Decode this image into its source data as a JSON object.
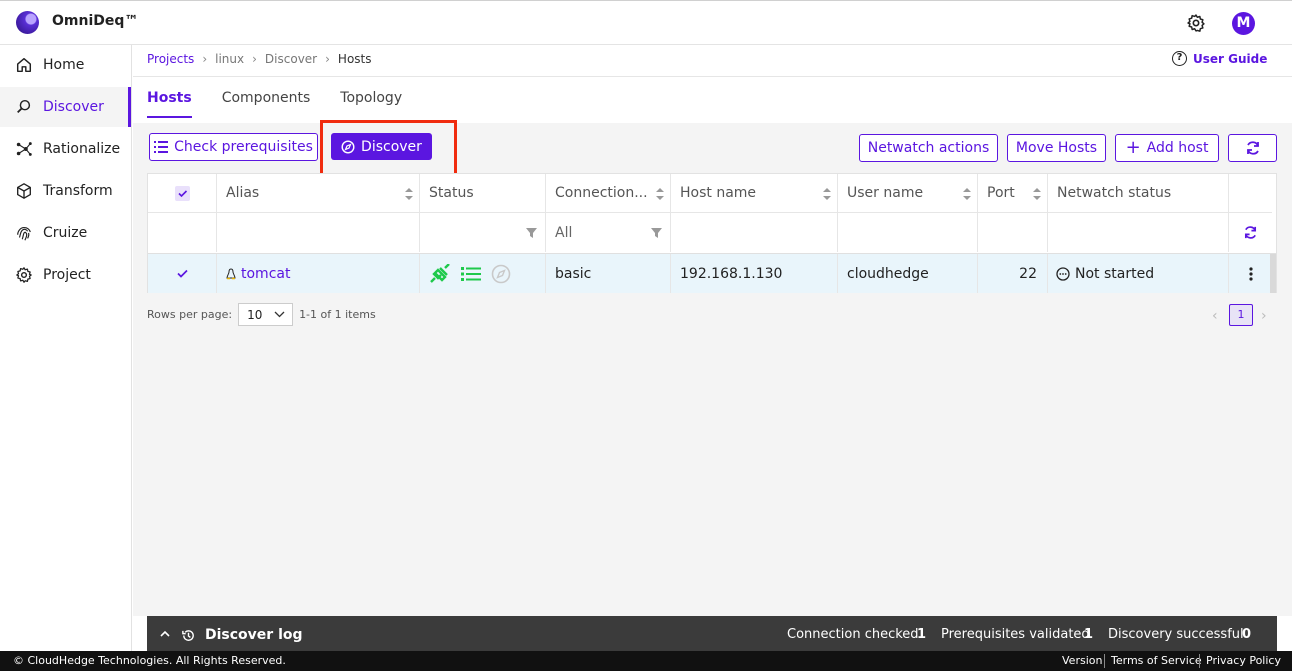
{
  "app": {
    "brand": "OmniDeq™",
    "avatar_initial": "M"
  },
  "sidebar": {
    "items": [
      {
        "label": "Home",
        "icon": "home-icon"
      },
      {
        "label": "Discover",
        "icon": "discover-icon",
        "active": true
      },
      {
        "label": "Rationalize",
        "icon": "rationalize-icon"
      },
      {
        "label": "Transform",
        "icon": "cube-icon"
      },
      {
        "label": "Cruize",
        "icon": "fingerprint-icon"
      },
      {
        "label": "Project",
        "icon": "gear-icon"
      }
    ]
  },
  "breadcrumb": {
    "items": [
      "Projects",
      "linux",
      "Discover",
      "Hosts"
    ]
  },
  "header": {
    "user_guide": "User Guide"
  },
  "tabs": [
    {
      "label": "Hosts",
      "active": true
    },
    {
      "label": "Components"
    },
    {
      "label": "Topology"
    }
  ],
  "toolbar": {
    "check_prereq": "Check prerequisites",
    "discover": "Discover",
    "netwatch_actions": "Netwatch actions",
    "move_hosts": "Move Hosts",
    "add_host": "Add host"
  },
  "table": {
    "columns": [
      "Alias",
      "Status",
      "Connection...",
      "Host name",
      "User name",
      "Port",
      "Netwatch status"
    ],
    "filter_connection": "All",
    "rows": [
      {
        "alias": "tomcat",
        "connection": "basic",
        "host_name": "192.168.1.130",
        "user_name": "cloudhedge",
        "port": "22",
        "netwatch_status": "Not started"
      }
    ]
  },
  "pagination": {
    "rows_label": "Rows per page:",
    "rows_value": "10",
    "range": "1-1 of 1 items",
    "page": "1"
  },
  "log": {
    "title": "Discover log",
    "stats": [
      {
        "label": "Connection checked",
        "value": "1"
      },
      {
        "label": "Prerequisites validated",
        "value": "1"
      },
      {
        "label": "Discovery successful",
        "value": "0"
      }
    ]
  },
  "footer": {
    "copyright": "© CloudHedge Technologies. All Rights Reserved.",
    "links": [
      "Version",
      "Terms of Service",
      "Privacy Policy"
    ]
  },
  "colors": {
    "accent": "#5b16e0",
    "status_green": "#1ec94b",
    "highlight": "#f02b0e"
  }
}
